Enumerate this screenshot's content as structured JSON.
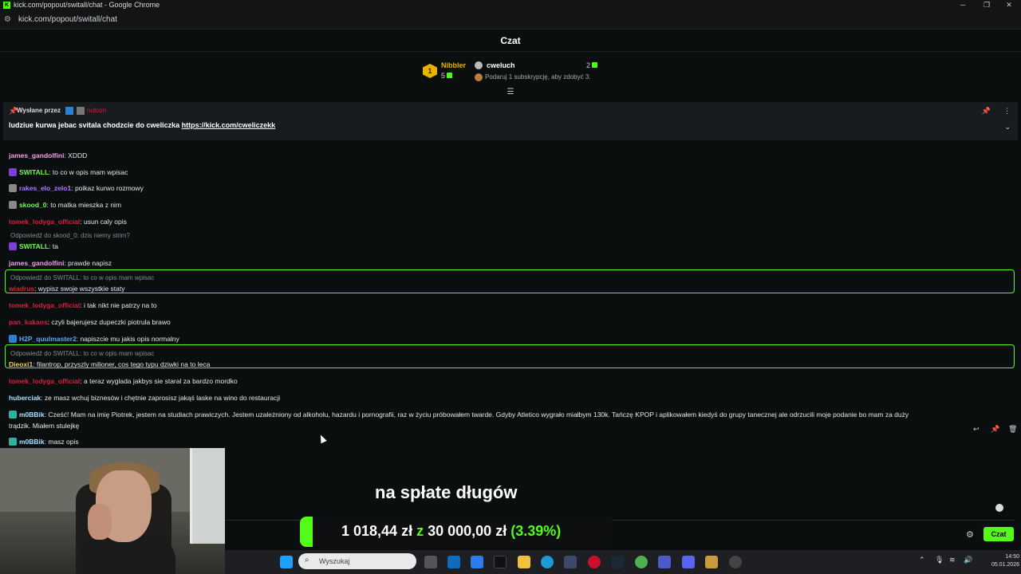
{
  "window": {
    "title": "kick.com/popout/switall/chat - Google Chrome",
    "url": "kick.com/popout/switall/chat",
    "logo": "K"
  },
  "chat_header": {
    "title": "Czat"
  },
  "leaderboard": {
    "rank": "1",
    "top_name": "Nibbler",
    "top_count": "5",
    "gifter_name": "cweluch",
    "gifter_count": "2",
    "gift_hint": "Podaruj 1 subskrypcję, aby zdobyć 3."
  },
  "pinned": {
    "sent_by_label": "Wysłane przez",
    "sent_by_user": "nutcon",
    "message_text": "ludziue kurwa jebac svitala chodzcie do cweliczka ",
    "message_link": "https://kick.com/cweliczekk"
  },
  "messages": [
    {
      "user": "james_gandolfini",
      "text": ": XDDD",
      "color": "#f2a0e9"
    },
    {
      "user": "SWITALL",
      "text": ": to co w opis mam wpisac",
      "color": "#73fc4e"
    },
    {
      "user": "rakes_elo_zelo1",
      "text": ": poikaz kurwo rozmowy",
      "color": "#b278ff"
    },
    {
      "user": "skood_0",
      "text": ": to matka mieszka z nim",
      "color": "#73fc4e"
    },
    {
      "user": "tomek_lodyga_official",
      "text": ": usun caly opis",
      "color": "#d4213b"
    },
    {
      "reply": "Odpowiedź do skood_0: dzis niemy strim?"
    },
    {
      "user": "SWITALL",
      "text": ": ta",
      "color": "#73fc4e"
    },
    {
      "user": "james_gandolfini",
      "text": ": prawde napisz",
      "color": "#f2a0e9"
    },
    {
      "reply": "Odpowiedź do SWITALL: to co w opis mam wpisac"
    },
    {
      "user": "wiadrus",
      "text": ": wypisz swoje wszystkie staty",
      "color": "#d4213b"
    },
    {
      "user": "tomek_lodyga_official",
      "text": ": i tak nikt nie patrzy na to",
      "color": "#d4213b"
    },
    {
      "user": "pan_kakaos",
      "text": ": czyli bajerujesz dupeczki piotrula brawo",
      "color": "#d4213b"
    },
    {
      "user": "H2P_quulmaster2",
      "text": ": napiszcie mu jakis opis normalny",
      "color": "#5aa8ff"
    },
    {
      "reply": "Odpowiedź do SWITALL: to co w opis mam wpisac"
    },
    {
      "user": "Dieoxi1",
      "text": ": filantrop, przyszly milioner, cos tego typu dziwki na to leca",
      "color": "#f2d14a"
    },
    {
      "user": "tomek_lodyga_official",
      "text": ": a teraz wyglada jakbys sie staral za bardzo mordko",
      "color": "#d4213b"
    },
    {
      "user": "huberciak",
      "text": ": ze masz wchuj biznesów i chętnie zaprosisz jakąś laske na wino do restauracji",
      "color": "#a7e0ff"
    },
    {
      "user": "m0BBik",
      "text": ": Cześć! Mam na imię Piotrek, jestem na studiach prawiczych. Jestem uzależniony od alkoholu, hazardu i pornografii, raz w życiu próbowałem twarde. Gdyby Atletico wygrało miałbym 130k. Tańczę KPOP i aplikowałem kiedyś do grupy tanecznej ale odrzucili moje podanie bo mam za duży",
      "color": "#a7e0ff"
    },
    {
      "continuation": "trądzik. Miałem stulejkę"
    },
    {
      "user": "m0BBik",
      "text": ": masz opis",
      "color": "#a7e0ff"
    }
  ],
  "overlay": {
    "subtitle": "na spłate długów",
    "goal_current": "1 018,44 zł",
    "goal_sep": "z",
    "goal_target": "30 000,00 zł",
    "goal_pct": "(3.39%)"
  },
  "chat_input": {
    "send_label": "Czat"
  },
  "taskbar": {
    "search_placeholder": "Wyszukaj",
    "time": "14:50",
    "date": "05.01.2026"
  },
  "colors": {
    "accent": "#53fc18",
    "background": "#0b0e0f"
  }
}
